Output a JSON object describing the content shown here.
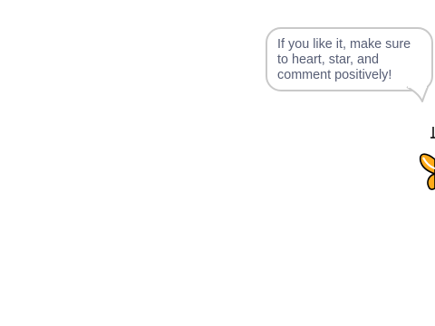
{
  "stage": {
    "background": "#ffffff"
  },
  "speech_bubble": {
    "text": "If you like it, make sure to heart, star, and comment positively!",
    "text_color": "#575e75",
    "border_color": "#c9c9c9"
  },
  "sprite": {
    "icon": "sprite-peek-icon",
    "fill_color": "#ffab19",
    "outline_color": "#000000"
  }
}
